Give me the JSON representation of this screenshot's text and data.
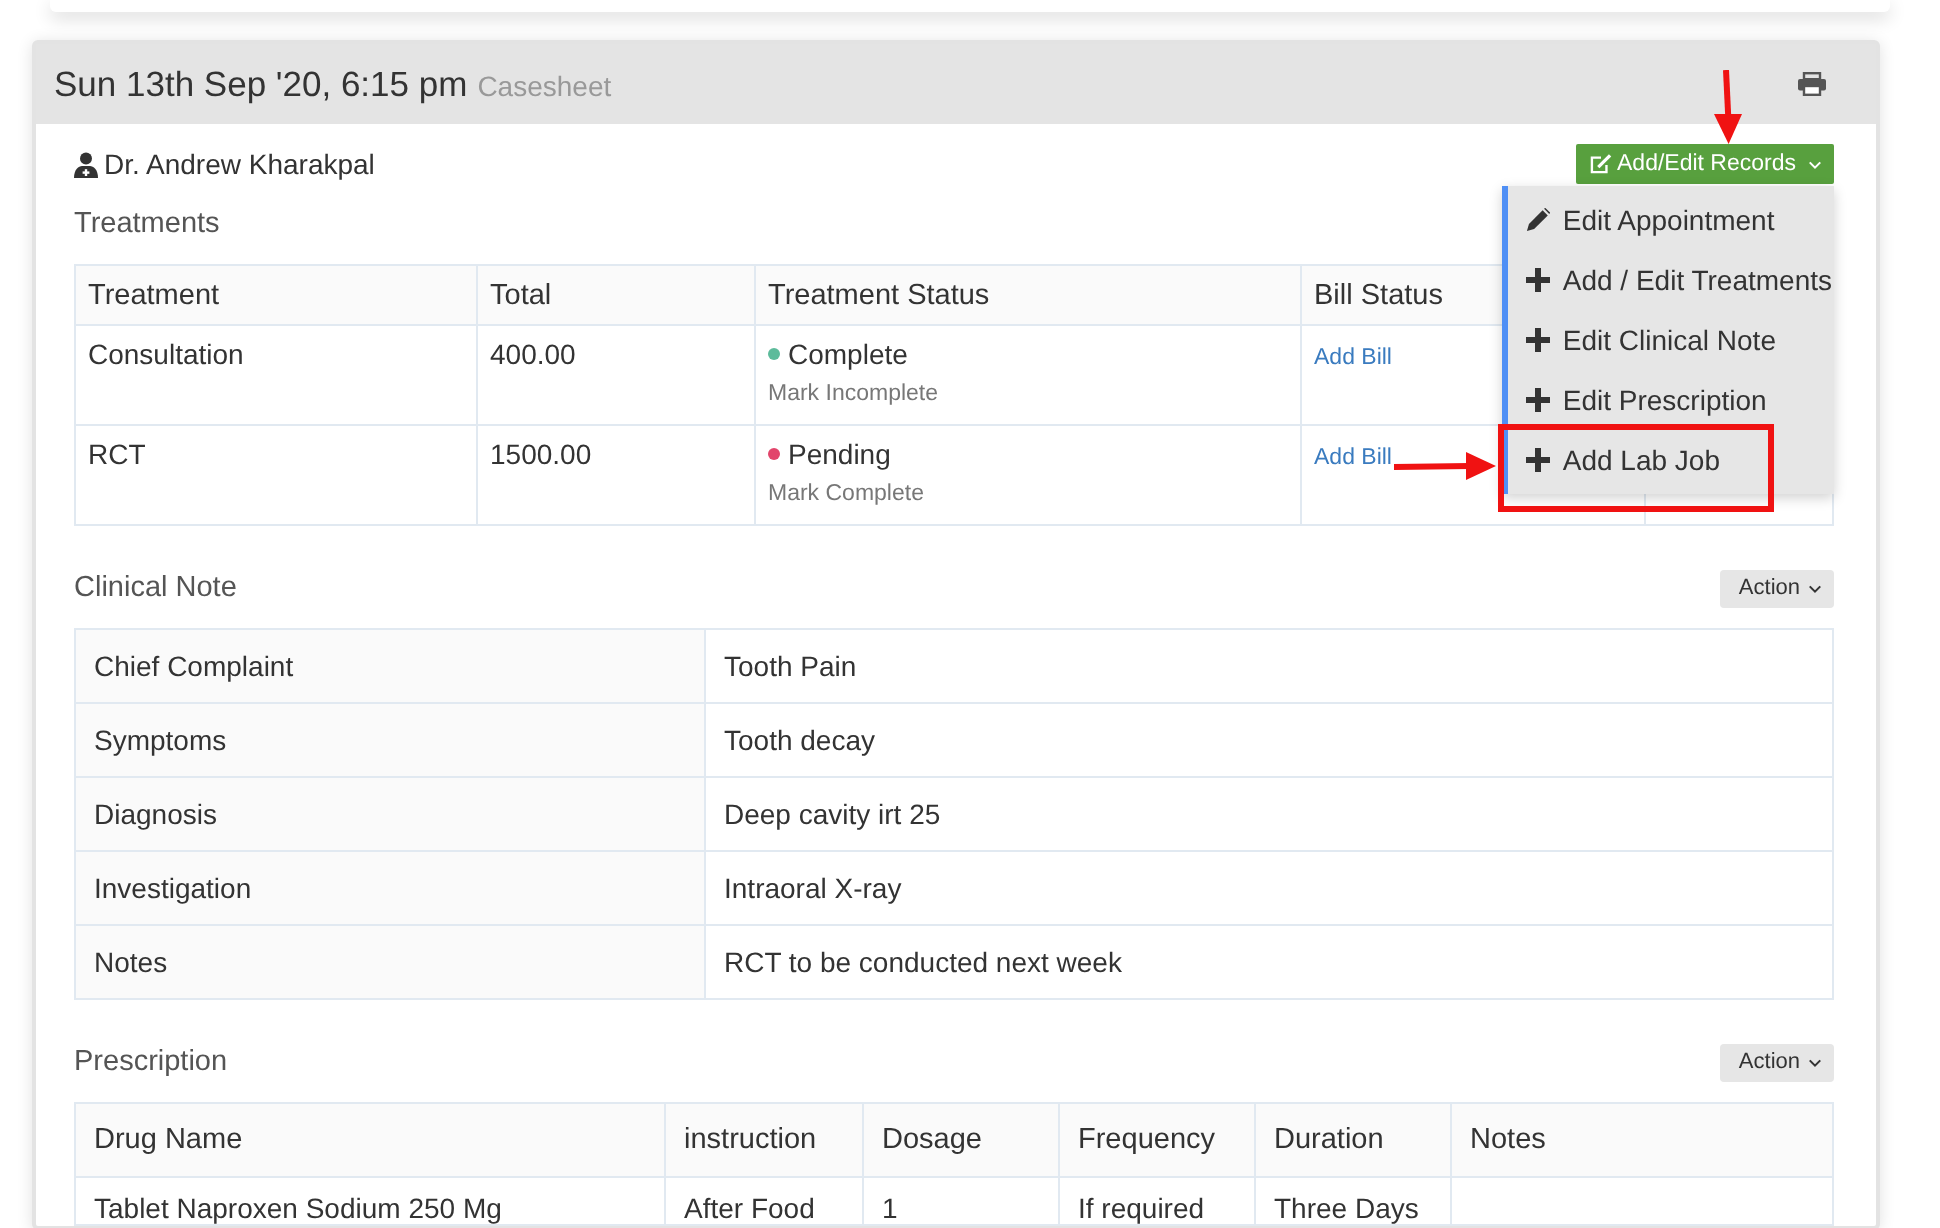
{
  "header": {
    "date": "Sun 13th Sep '20, 6:15 pm",
    "subtitle": "Casesheet"
  },
  "doctor": "Dr. Andrew Kharakpal",
  "records_button": {
    "label": "Add/Edit Records",
    "expanded": true,
    "pointed": true
  },
  "records_menu": [
    {
      "kind": "edit",
      "label": "Edit Appointment",
      "highlighted": false
    },
    {
      "kind": "add",
      "label": "Add / Edit Treatments",
      "highlighted": false
    },
    {
      "kind": "add",
      "label": "Edit Clinical Note",
      "highlighted": false
    },
    {
      "kind": "add",
      "label": "Edit Prescription",
      "highlighted": false
    },
    {
      "kind": "add",
      "label": "Add Lab Job",
      "highlighted": true
    }
  ],
  "treatments": {
    "title": "Treatments",
    "columns": [
      "Treatment",
      "Total",
      "Treatment Status",
      "Bill Status"
    ],
    "rows": [
      {
        "treatment": "Consultation",
        "total": "400.00",
        "status": "Complete",
        "color": "#5dbb9b",
        "status_action": "Mark Incomplete",
        "bill_action": "Add Bill"
      },
      {
        "treatment": "RCT",
        "total": "1500.00",
        "status": "Pending",
        "color": "#e2456b",
        "status_action": "Mark Complete",
        "bill_action": "Add Bill"
      }
    ]
  },
  "clinical_note": {
    "title": "Clinical Note",
    "action": "Action",
    "rows": [
      {
        "label": "Chief Complaint",
        "value": "Tooth Pain"
      },
      {
        "label": "Symptoms",
        "value": "Tooth decay"
      },
      {
        "label": "Diagnosis",
        "value": "Deep cavity irt 25"
      },
      {
        "label": "Investigation",
        "value": "Intraoral X-ray"
      },
      {
        "label": "Notes",
        "value": "RCT to be conducted next week"
      }
    ]
  },
  "prescription": {
    "title": "Prescription",
    "action": "Action",
    "columns": [
      "Drug Name",
      "instruction",
      "Dosage",
      "Frequency",
      "Duration",
      "Notes"
    ],
    "rows": [
      [
        "Tablet Naproxen Sodium 250 Mg",
        "After Food",
        "1",
        "If required",
        "Three Days"
      ]
    ]
  }
}
